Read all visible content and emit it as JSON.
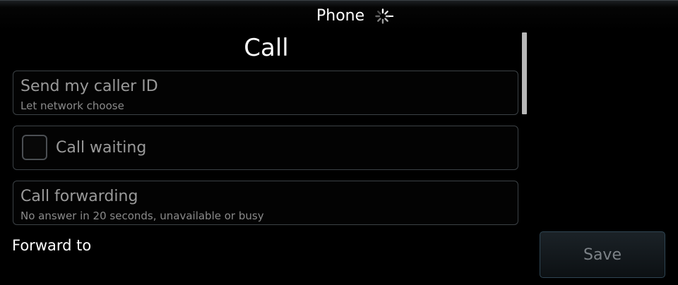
{
  "window": {
    "title": "Phone",
    "spinner_icon": "loading-spinner-icon"
  },
  "page": {
    "heading": "Call"
  },
  "settings": [
    {
      "title": "Send my caller ID",
      "subtitle": "Let network choose"
    },
    {
      "title": "Call waiting",
      "checked": false
    },
    {
      "title": "Call forwarding",
      "subtitle": "No answer in 20 seconds, unavailable or busy"
    }
  ],
  "forward": {
    "label": "Forward to"
  },
  "actions": {
    "save_label": "Save",
    "save_enabled": false
  },
  "colors": {
    "background": "#000000",
    "text": "#ffffff",
    "muted_text": "#9a9a9a",
    "border": "#3c4246"
  }
}
